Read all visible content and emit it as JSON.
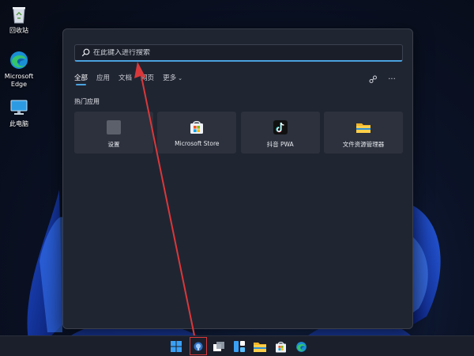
{
  "desktop": {
    "icons": [
      {
        "label": "回收站",
        "icon": "recycle-bin-icon"
      },
      {
        "label": "Microsoft\nEdge",
        "icon": "edge-icon"
      },
      {
        "label": "此电脑",
        "icon": "this-pc-icon"
      }
    ]
  },
  "start_menu": {
    "search": {
      "placeholder": "在此键入进行搜索",
      "value": ""
    },
    "tabs": [
      {
        "label": "全部",
        "active": true
      },
      {
        "label": "应用",
        "active": false
      },
      {
        "label": "文档",
        "active": false
      },
      {
        "label": "网页",
        "active": false
      },
      {
        "label": "更多",
        "active": false
      }
    ],
    "tools": {
      "share_icon": "share-icon",
      "more_icon": "more-icon",
      "more_label": "···"
    },
    "section_title": "热门应用",
    "apps": [
      {
        "label": "设置",
        "icon": "settings-icon"
      },
      {
        "label": "Microsoft Store",
        "icon": "store-icon"
      },
      {
        "label": "抖音 PWA",
        "icon": "tiktok-icon"
      },
      {
        "label": "文件资源管理器",
        "icon": "folder-icon"
      }
    ]
  },
  "taskbar": {
    "items": [
      "start-icon",
      "search-icon",
      "task-view-icon",
      "widgets-icon",
      "file-explorer-icon",
      "store-icon",
      "edge-icon"
    ],
    "highlighted": "search-icon"
  },
  "colors": {
    "accent": "#4aa3df",
    "annotation": "#d9383a",
    "panel_bg": "#202532",
    "tile_bg": "#2c313d"
  }
}
